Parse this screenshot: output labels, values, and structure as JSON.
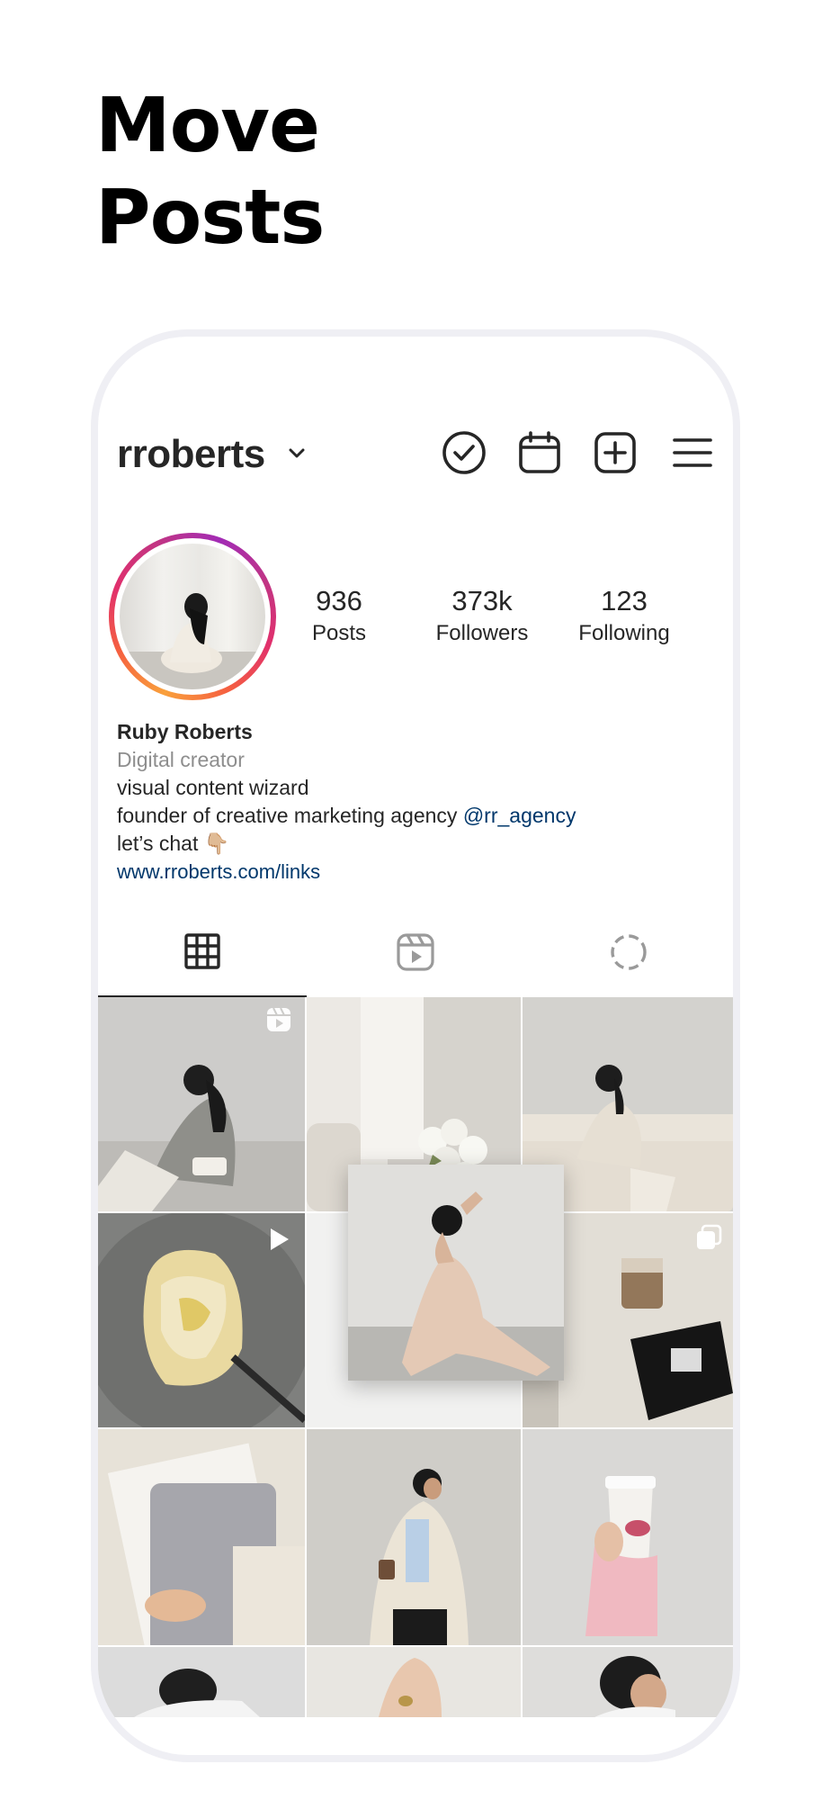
{
  "headline": {
    "line1": "Move",
    "line2": "Posts"
  },
  "profile": {
    "username": "rroberts",
    "stats": [
      {
        "value": "936",
        "label": "Posts"
      },
      {
        "value": "373k",
        "label": "Followers"
      },
      {
        "value": "123",
        "label": "Following"
      }
    ],
    "bio": {
      "name": "Ruby Roberts",
      "category": "Digital creator",
      "line1": "visual content wizard",
      "line2_text": "founder of creative marketing agency ",
      "line2_mention": "@rr_agency",
      "line3": "let’s chat 👇🏼",
      "link": "www.rroberts.com/links"
    }
  },
  "tabs": [
    {
      "icon": "grid-icon",
      "active": true
    },
    {
      "icon": "reels-icon",
      "active": false
    },
    {
      "icon": "tagged-icon",
      "active": false
    }
  ],
  "colors": {
    "accent_link": "#00376b",
    "ring_start": "#f9a03c",
    "ring_end": "#c13584",
    "frame": "#efeff4"
  }
}
